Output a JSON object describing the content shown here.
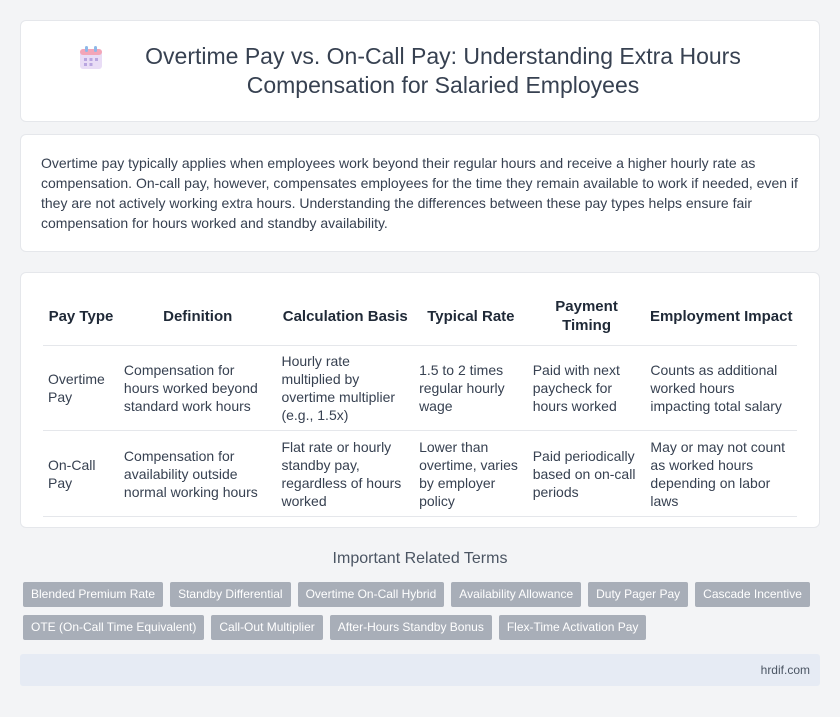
{
  "title": "Overtime Pay vs. On-Call Pay: Understanding Extra Hours Compensation for Salaried Employees",
  "title_icon": "calendar-icon",
  "intro": "Overtime pay typically applies when employees work beyond their regular hours and receive a higher hourly rate as compensation. On-call pay, however, compensates employees for the time they remain available to work if needed, even if they are not actively working extra hours. Understanding the differences between these pay types helps ensure fair compensation for hours worked and standby availability.",
  "table": {
    "headers": [
      "Pay Type",
      "Definition",
      "Calculation Basis",
      "Typical Rate",
      "Payment Timing",
      "Employment Impact"
    ],
    "rows": [
      [
        "Overtime Pay",
        "Compensation for hours worked beyond standard work hours",
        "Hourly rate multiplied by overtime multiplier (e.g., 1.5x)",
        "1.5 to 2 times regular hourly wage",
        "Paid with next paycheck for hours worked",
        "Counts as additional worked hours impacting total salary"
      ],
      [
        "On-Call Pay",
        "Compensation for availability outside normal working hours",
        "Flat rate or hourly standby pay, regardless of hours worked",
        "Lower than overtime, varies by employer policy",
        "Paid periodically based on on-call periods",
        "May or may not count as worked hours depending on labor laws"
      ]
    ]
  },
  "related": {
    "title": "Important Related Terms",
    "tags_row1": [
      "Blended Premium Rate",
      "Standby Differential",
      "Overtime On-Call Hybrid",
      "Availability Allowance",
      "Duty Pager Pay",
      "Cascade Incentive"
    ],
    "tags_row2": [
      "OTE (On-Call Time Equivalent)",
      "Call-Out Multiplier",
      "After-Hours Standby Bonus",
      "Flex-Time Activation Pay"
    ]
  },
  "footer": "hrdif.com"
}
